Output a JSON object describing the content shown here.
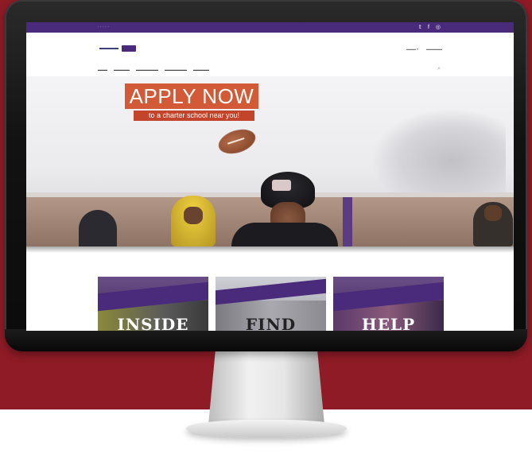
{
  "hero": {
    "headline": "APPLY NOW",
    "subheadline": "to a charter school near you!",
    "headline_color": "#d25a36"
  },
  "tiles": [
    {
      "label": "INSIDE"
    },
    {
      "label": "FIND"
    },
    {
      "label": "HELP"
    }
  ],
  "topbar": {
    "social_icons": [
      "twitter-icon",
      "facebook-icon",
      "instagram-icon"
    ],
    "social_glyphs": [
      "𝕥",
      "f",
      "◎"
    ]
  },
  "colors": {
    "brand_purple": "#4a2a7a",
    "backdrop_red": "#8e1b26"
  }
}
